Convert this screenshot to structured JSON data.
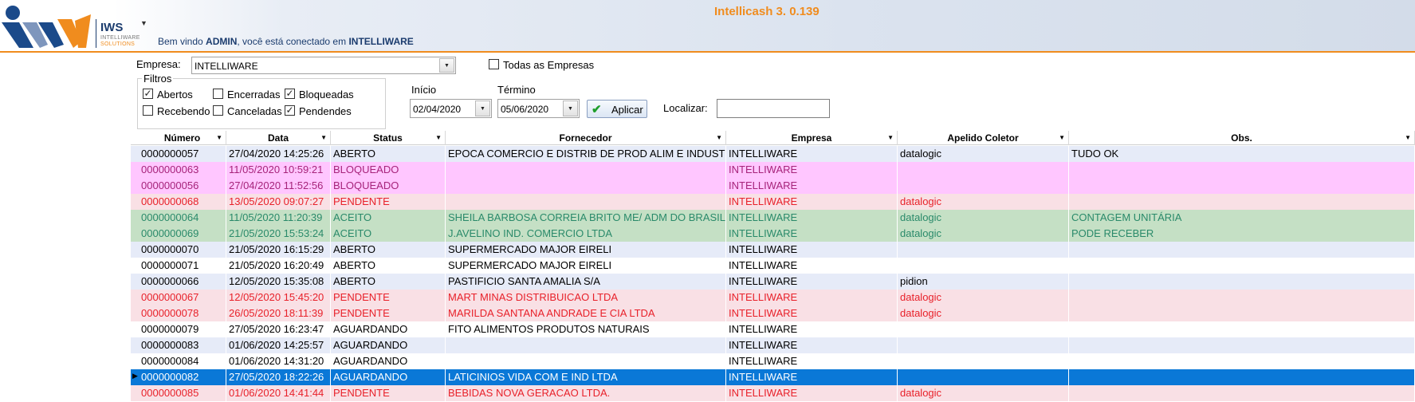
{
  "header": {
    "logo_text": "IWS",
    "logo_sub1": "INTELLIWARE",
    "logo_sub2": "SOLUTIONS",
    "welcome_prefix": "Bem vindo ",
    "welcome_user": "ADMIN",
    "welcome_middle": ", você está conectado em ",
    "welcome_company": "INTELLIWARE",
    "app_title": "Intellicash 3. 0.139",
    "logo_menu_icon": "chevron-down-icon"
  },
  "filters": {
    "empresa_label": "Empresa:",
    "empresa_value": "INTELLIWARE",
    "todas_label": "Todas as Empresas",
    "todas_checked": false,
    "filtros_title": "Filtros",
    "checks": [
      {
        "label": "Abertos",
        "checked": true
      },
      {
        "label": "Encerradas",
        "checked": false
      },
      {
        "label": "Bloqueadas",
        "checked": true
      },
      {
        "label": "Recebendo",
        "checked": false
      },
      {
        "label": "Canceladas",
        "checked": false
      },
      {
        "label": "Pendendes",
        "checked": true
      }
    ],
    "inicio_label": "Início",
    "inicio_value": "02/04/2020",
    "termino_label": "Término",
    "termino_value": "05/06/2020",
    "apply_label": "Aplicar",
    "localizar_label": "Localizar:",
    "localizar_value": ""
  },
  "grid": {
    "columns": [
      "Número",
      "Data",
      "Status",
      "Fornecedor",
      "Empresa",
      "Apelido Coletor",
      "Obs."
    ],
    "colors": {
      "blue_bg": "#e6ebf8",
      "white_bg": "#ffffff",
      "pink_bg": "#ffc6ff",
      "red_bg": "#f9e0e5",
      "green_bg": "#c5e0c5",
      "selected_bg": "#0a78d7",
      "red_text": "#e8212a",
      "green_text": "#2a8a6a",
      "magenta_text": "#a6237a"
    },
    "rows": [
      {
        "numero": "0000000057",
        "data": "27/04/2020 14:25:26",
        "status": "ABERTO",
        "fornecedor": "EPOCA COMERCIO E DISTRIB DE PROD ALIM E INDUSTR",
        "empresa": "INTELLIWARE",
        "apelido": "datalogic",
        "obs": "TUDO OK",
        "style": "blue"
      },
      {
        "numero": "0000000063",
        "data": "11/05/2020 10:59:21",
        "status": "BLOQUEADO",
        "fornecedor": "",
        "empresa": "INTELLIWARE",
        "apelido": "",
        "obs": "",
        "style": "pink"
      },
      {
        "numero": "0000000056",
        "data": "27/04/2020 11:52:56",
        "status": "BLOQUEADO",
        "fornecedor": "",
        "empresa": "INTELLIWARE",
        "apelido": "",
        "obs": "",
        "style": "pink"
      },
      {
        "numero": "0000000068",
        "data": "13/05/2020 09:07:27",
        "status": "PENDENTE",
        "fornecedor": "",
        "empresa": "INTELLIWARE",
        "apelido": "datalogic",
        "obs": "",
        "style": "red"
      },
      {
        "numero": "0000000064",
        "data": "11/05/2020 11:20:39",
        "status": "ACEITO",
        "fornecedor": "SHEILA BARBOSA CORREIA BRITO ME/ ADM DO BRASIL",
        "empresa": "INTELLIWARE",
        "apelido": "datalogic",
        "obs": "CONTAGEM UNITÁRIA",
        "style": "green"
      },
      {
        "numero": "0000000069",
        "data": "21/05/2020 15:53:24",
        "status": "ACEITO",
        "fornecedor": "J.AVELINO IND. COMERCIO LTDA",
        "empresa": "INTELLIWARE",
        "apelido": "datalogic",
        "obs": "PODE RECEBER",
        "style": "green"
      },
      {
        "numero": "0000000070",
        "data": "21/05/2020 16:15:29",
        "status": "ABERTO",
        "fornecedor": "SUPERMERCADO MAJOR EIRELI",
        "empresa": "INTELLIWARE",
        "apelido": "",
        "obs": "",
        "style": "blue"
      },
      {
        "numero": "0000000071",
        "data": "21/05/2020 16:20:49",
        "status": "ABERTO",
        "fornecedor": "SUPERMERCADO MAJOR EIRELI",
        "empresa": "INTELLIWARE",
        "apelido": "",
        "obs": "",
        "style": "white"
      },
      {
        "numero": "0000000066",
        "data": "12/05/2020 15:35:08",
        "status": "ABERTO",
        "fornecedor": "PASTIFICIO SANTA AMALIA S/A",
        "empresa": "INTELLIWARE",
        "apelido": "pidion",
        "obs": "",
        "style": "blue"
      },
      {
        "numero": "0000000067",
        "data": "12/05/2020 15:45:20",
        "status": "PENDENTE",
        "fornecedor": "MART MINAS DISTRIBUICAO LTDA",
        "empresa": "INTELLIWARE",
        "apelido": "datalogic",
        "obs": "",
        "style": "red"
      },
      {
        "numero": "0000000078",
        "data": "26/05/2020 18:11:39",
        "status": "PENDENTE",
        "fornecedor": "MARILDA SANTANA ANDRADE E CIA LTDA",
        "empresa": "INTELLIWARE",
        "apelido": "datalogic",
        "obs": "",
        "style": "red"
      },
      {
        "numero": "0000000079",
        "data": "27/05/2020 16:23:47",
        "status": "AGUARDANDO",
        "fornecedor": "FITO ALIMENTOS PRODUTOS NATURAIS",
        "empresa": "INTELLIWARE",
        "apelido": "",
        "obs": "",
        "style": "white"
      },
      {
        "numero": "0000000083",
        "data": "01/06/2020 14:25:57",
        "status": "AGUARDANDO",
        "fornecedor": "",
        "empresa": "INTELLIWARE",
        "apelido": "",
        "obs": "",
        "style": "blue"
      },
      {
        "numero": "0000000084",
        "data": "01/06/2020 14:31:20",
        "status": "AGUARDANDO",
        "fornecedor": "",
        "empresa": "INTELLIWARE",
        "apelido": "",
        "obs": "",
        "style": "white"
      },
      {
        "numero": "0000000082",
        "data": "27/05/2020 18:22:26",
        "status": "AGUARDANDO",
        "fornecedor": "LATICINIOS VIDA COM E IND LTDA",
        "empresa": "INTELLIWARE",
        "apelido": "",
        "obs": "",
        "style": "selected"
      },
      {
        "numero": "0000000085",
        "data": "01/06/2020 14:41:44",
        "status": "PENDENTE",
        "fornecedor": "BEBIDAS NOVA GERACAO LTDA.",
        "empresa": "INTELLIWARE",
        "apelido": "datalogic",
        "obs": "",
        "style": "red"
      }
    ]
  }
}
